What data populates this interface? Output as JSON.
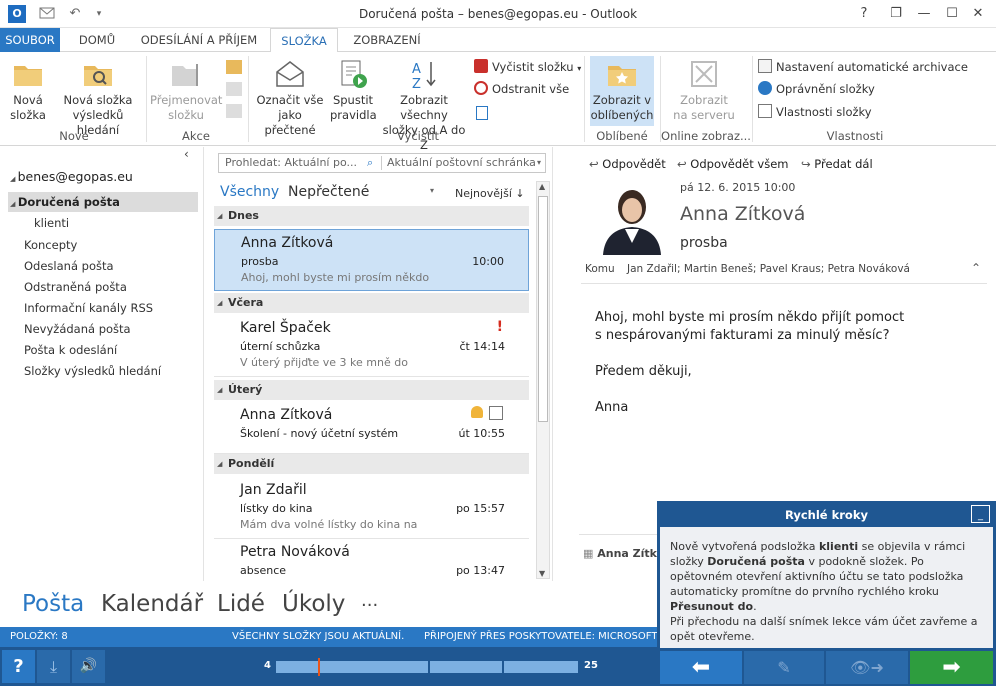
{
  "app": {
    "title": "Doručená pošta – benes@egopas.eu - Outlook",
    "logo_letters": "O"
  },
  "window": {
    "help": "?",
    "restore": "❐",
    "minimize": "—",
    "maximize": "☐",
    "close": "✕"
  },
  "tabs": [
    "SOUBOR",
    "DOMŮ",
    "ODESÍLÁNÍ A PŘÍJEM",
    "SLOŽKA",
    "ZOBRAZENÍ"
  ],
  "ribbon": {
    "new_folder": [
      "Nová",
      "složka"
    ],
    "new_search_folder": [
      "Nová složka",
      "výsledků hledání"
    ],
    "rename_folder": [
      "Přejmenovat",
      "složku"
    ],
    "mark_all_read": [
      "Označit vše",
      "jako přečtené"
    ],
    "run_rules": [
      "Spustit",
      "pravidla"
    ],
    "show_all_az": [
      "Zobrazit všechny",
      "složky od A do Z"
    ],
    "clean_folder": "Vyčistit složku",
    "delete_all": "Odstranit vše",
    "show_favorites": [
      "Zobrazit v",
      "oblíbených"
    ],
    "show_on_server": [
      "Zobrazit",
      "na serveru"
    ],
    "autoarchive": "Nastavení automatické archivace",
    "folder_permissions": "Oprávnění složky",
    "folder_properties": "Vlastnosti složky",
    "groups": {
      "new": "Nové",
      "actions": "Akce",
      "cleanup": "Vyčistit",
      "favorites": "Oblíbené",
      "online": "Online zobraz...",
      "properties": "Vlastnosti"
    }
  },
  "nav": {
    "account": "benes@egopas.eu",
    "folders": [
      "Doručená pošta",
      "klienti",
      "Koncepty",
      "Odeslaná pošta",
      "Odstraněná pošta",
      "Informační kanály RSS",
      "Nevyžádaná pošta",
      "Pošta k odeslání",
      "Složky výsledků hledání"
    ]
  },
  "list": {
    "search_placeholder": "Prohledat: Aktuální po...",
    "scope": "Aktuální poštovní schránka",
    "filter_all": "Všechny",
    "filter_unread": "Nepřečtené",
    "sort": "Nejnovější",
    "groups": [
      "Dnes",
      "Včera",
      "Úterý",
      "Pondělí"
    ],
    "mails": [
      {
        "from": "Anna Zítková",
        "subject": "prosba",
        "preview": "Ahoj, mohl byste mi prosím někdo",
        "time": "10:00"
      },
      {
        "from": "Karel Špaček",
        "subject": "úterní schůzka",
        "preview": "V úterý přijďte ve 3 ke mně do",
        "time": "čt 14:14",
        "flag": "!"
      },
      {
        "from": "Anna Zítková",
        "subject": "Školení - nový účetní systém",
        "preview": "",
        "time": "út 10:55"
      },
      {
        "from": "Jan Zdařil",
        "subject": "lístky do kina",
        "preview": "Mám dva volné lístky do kina na",
        "time": "po 15:57"
      },
      {
        "from": "Petra Nováková",
        "subject": "absence",
        "preview": "",
        "time": "po 13:47"
      }
    ]
  },
  "reading": {
    "reply": "Odpovědět",
    "reply_all": "Odpovědět všem",
    "forward": "Předat dál",
    "date": "pá 12. 6. 2015 10:00",
    "sender": "Anna Zítková",
    "subject": "prosba",
    "to_label": "Komu",
    "to": "Jan Zdařil; Martin Beneš; Pavel Kraus; Petra Nováková",
    "body": [
      "Ahoj, mohl byste mi prosím někdo přijít pomoct",
      "s nespárovanými fakturami za minulý měsíc?",
      "Předem děkuji,",
      "Anna"
    ],
    "footer_sender": "Anna Zítkov"
  },
  "bottom_nav": [
    "Pošta",
    "Kalendář",
    "Lidé",
    "Úkoly",
    "···"
  ],
  "status": {
    "items": "POLOŽKY: 8",
    "sync": "VŠECHNY SLOŽKY JSOU AKTUÁLNÍ.",
    "connected": "PŘIPOJENÝ PŘES POSKYTOVATELE: MICROSOFT"
  },
  "player": {
    "help": "?",
    "start": "4",
    "end": "25",
    "progress": 0.14
  },
  "quick_steps": {
    "title": "Rychlé kroky",
    "p1": [
      "Nově vytvořená podsložka ",
      "klienti",
      " se objevila v rámci složky ",
      "Doručená pošta",
      " v podokně složek. Po opětovném otevření aktivního účtu se tato podsložka automaticky promítne do prvního rychlého kroku ",
      "Přesunout do",
      "."
    ],
    "p2": "Při přechodu na další snímek lekce vám účet zavřeme a opět otevřeme."
  },
  "colors": {
    "accent": "#2a78c4",
    "player": "#1f5792",
    "next_green": "#2e9d3e",
    "selected_mail": "#cde2f6"
  }
}
